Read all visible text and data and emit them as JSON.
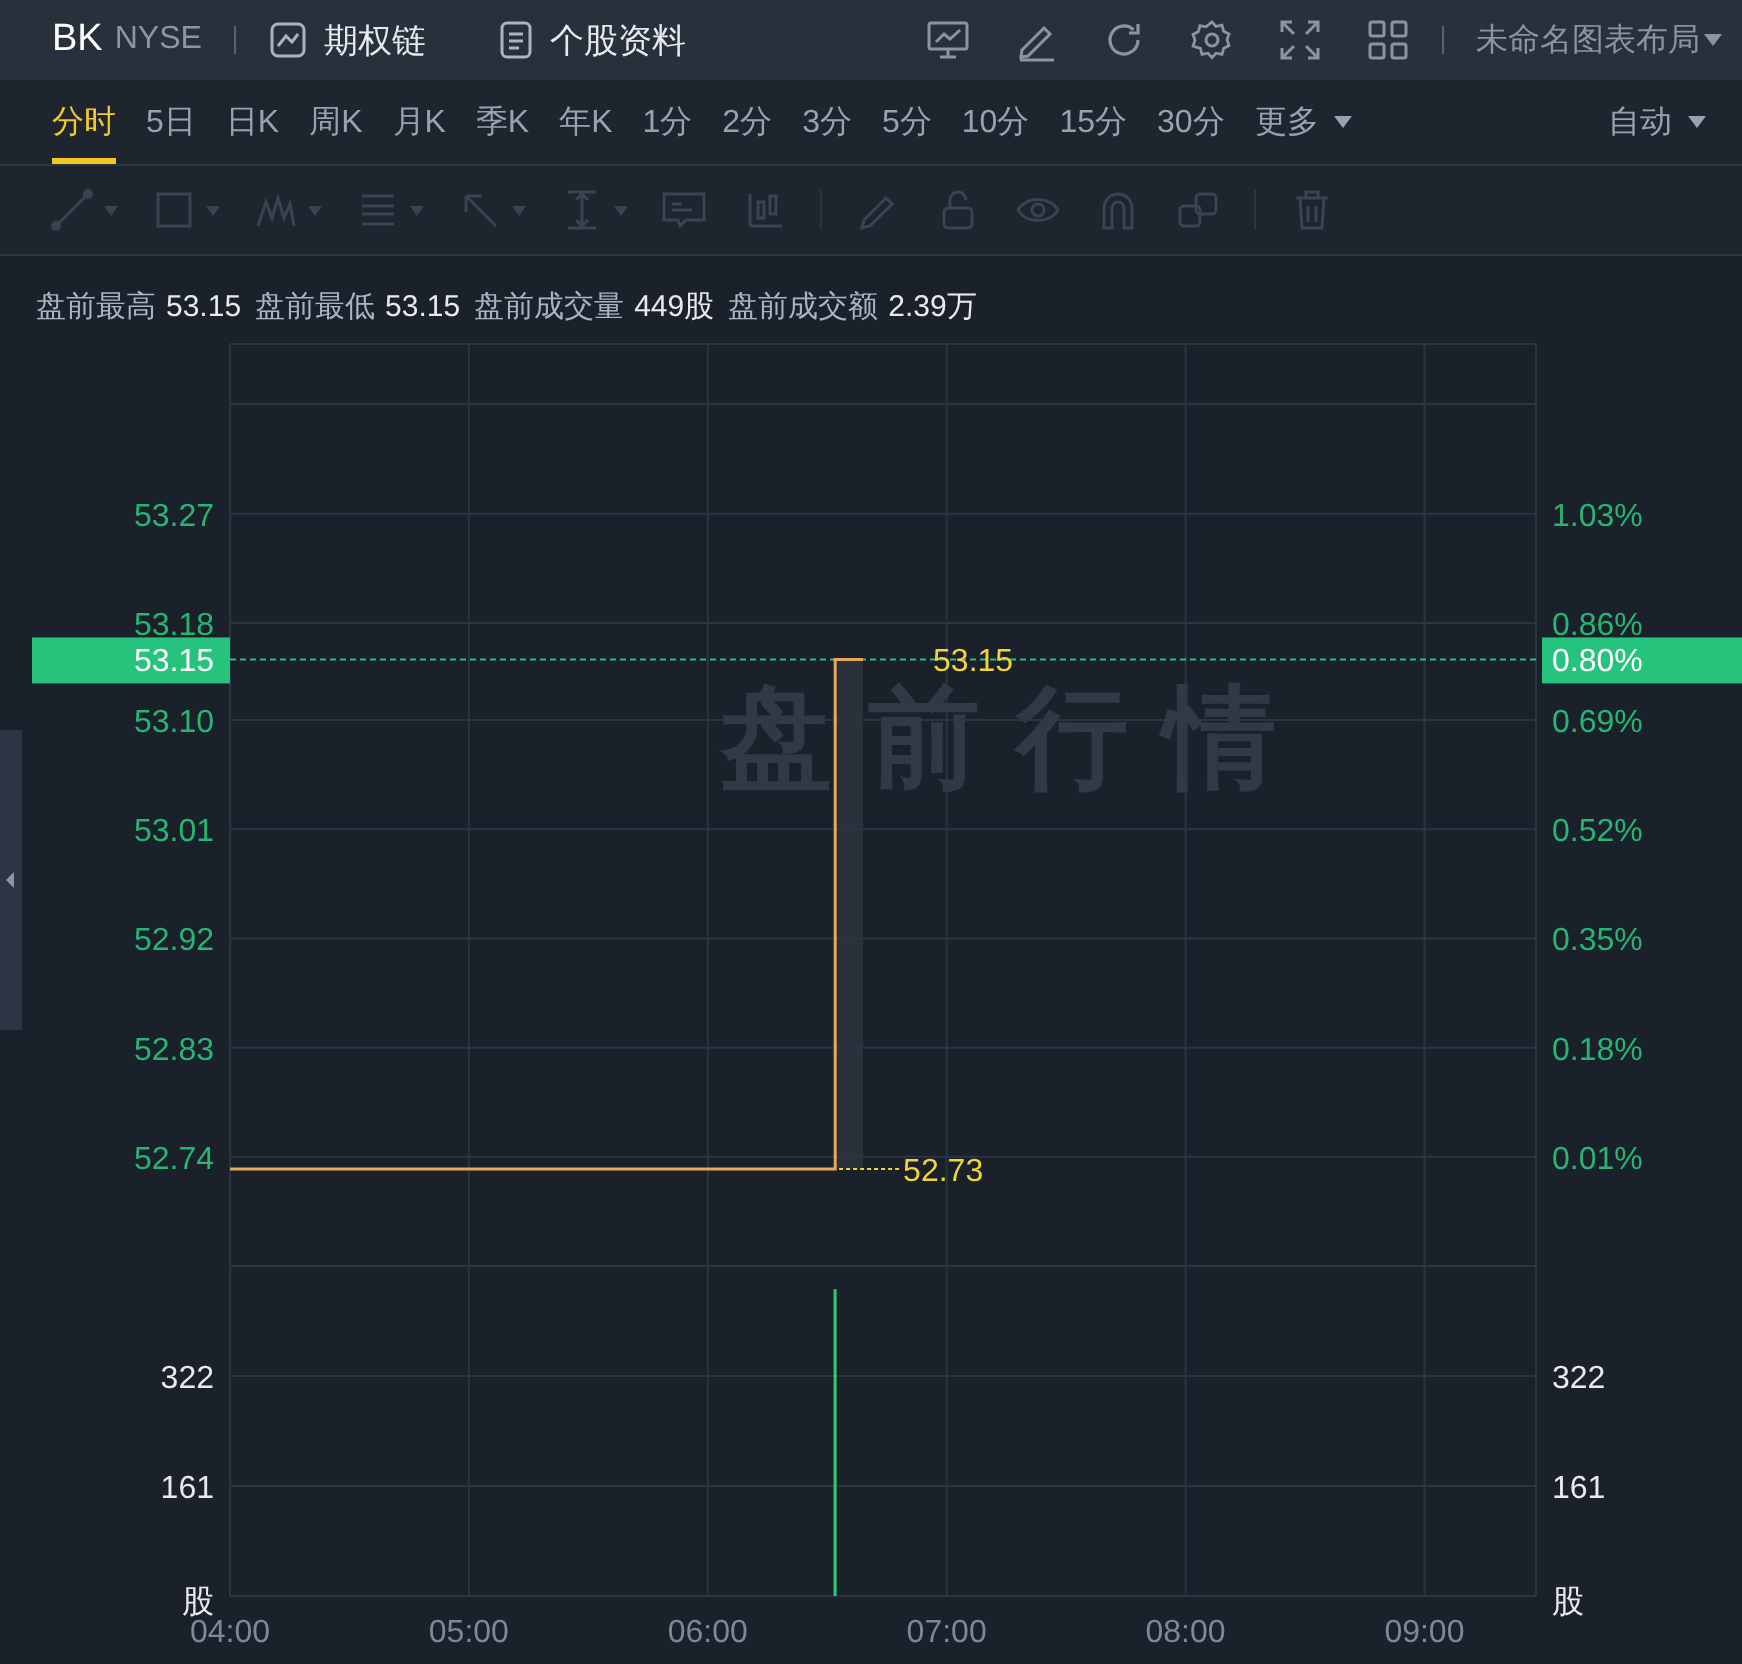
{
  "header": {
    "symbol": "BK",
    "exchange": "NYSE",
    "links": [
      {
        "kind": "chain",
        "label": "期权链"
      },
      {
        "kind": "profile",
        "label": "个股资料"
      }
    ],
    "tools": [
      {
        "kind": "monitor"
      },
      {
        "kind": "pen"
      },
      {
        "kind": "refresh"
      },
      {
        "kind": "gear"
      },
      {
        "kind": "expand"
      },
      {
        "kind": "grid"
      }
    ],
    "layout_menu": "未命名图表布局"
  },
  "timeframes": [
    {
      "label": "分时",
      "selected": true
    },
    {
      "label": "5日",
      "selected": false
    },
    {
      "label": "日K",
      "selected": false
    },
    {
      "label": "周K",
      "selected": false
    },
    {
      "label": "月K",
      "selected": false
    },
    {
      "label": "季K",
      "selected": false
    },
    {
      "label": "年K",
      "selected": false
    },
    {
      "label": "1分",
      "selected": false
    },
    {
      "label": "2分",
      "selected": false
    },
    {
      "label": "3分",
      "selected": false
    },
    {
      "label": "5分",
      "selected": false
    },
    {
      "label": "10分",
      "selected": false
    },
    {
      "label": "15分",
      "selected": false
    },
    {
      "label": "30分",
      "selected": false
    }
  ],
  "more_menu": "更多",
  "scale_menu": "自动",
  "drawing_tools": [
    {
      "kind": "line",
      "disabled": true
    },
    {
      "kind": "rect",
      "disabled": true
    },
    {
      "kind": "wave",
      "disabled": true
    },
    {
      "kind": "fib",
      "disabled": true
    },
    {
      "kind": "arrow",
      "disabled": true
    },
    {
      "kind": "measure",
      "disabled": true
    },
    {
      "kind": "note",
      "disabled": true
    },
    {
      "kind": "candles",
      "disabled": true
    },
    {
      "kind": "sep"
    },
    {
      "kind": "pen",
      "disabled": true
    },
    {
      "kind": "lock",
      "disabled": true
    },
    {
      "kind": "eye",
      "disabled": true
    },
    {
      "kind": "magnet",
      "disabled": true
    },
    {
      "kind": "copy",
      "disabled": true
    },
    {
      "kind": "sep"
    },
    {
      "kind": "trash",
      "disabled": true
    }
  ],
  "stats": [
    {
      "label": "盘前最高",
      "value": "53.15"
    },
    {
      "label": "盘前最低",
      "value": "53.15"
    },
    {
      "label": "盘前成交量",
      "value": "449股"
    },
    {
      "label": "盘前成交额",
      "value": "2.39万"
    }
  ],
  "price_chart": {
    "watermark": "盘前行情",
    "percent_ticks": [
      "1.03%",
      "0.86%",
      "0.69%",
      "0.52%",
      "0.35%",
      "0.18%",
      "0.01%"
    ],
    "last_price": {
      "price": "53.15",
      "percent": "0.80%"
    },
    "high_label": "53.15",
    "low_label": "52.73",
    "chart_data": {
      "type": "line",
      "grid": true,
      "ref_lines": [
        {
          "axis": "y",
          "value": 53.15,
          "color": "#27c07c"
        }
      ],
      "x": [
        4,
        6.533,
        6.533,
        6.65
      ],
      "xlim": [
        4,
        9.467
      ],
      "ylim": [
        52.65,
        53.41
      ],
      "yticks": [
        {
          "value": 53.27,
          "label": "53.27"
        },
        {
          "value": 53.18,
          "label": "53.18"
        },
        {
          "value": 53.1,
          "label": "53.10"
        },
        {
          "value": 53.01,
          "label": "53.01"
        },
        {
          "value": 52.92,
          "label": "52.92"
        },
        {
          "value": 52.83,
          "label": "52.83"
        },
        {
          "value": 52.74,
          "label": "52.74"
        }
      ],
      "series": [
        {
          "color": "#e8a85c",
          "values": [
            52.73,
            52.73,
            53.15,
            53.15
          ]
        }
      ]
    }
  },
  "volume_chart": {
    "unit_left": "股",
    "unit_right": "股",
    "right_ticks": [
      "322",
      "161"
    ],
    "chart_data": {
      "type": "bar",
      "grid": true,
      "x": [
        6.533
      ],
      "values": [
        449
      ],
      "xlim": [
        4,
        9.467
      ],
      "xticks": [
        {
          "value": 4,
          "label": "04:00"
        },
        {
          "value": 5,
          "label": "05:00"
        },
        {
          "value": 6,
          "label": "06:00"
        },
        {
          "value": 7,
          "label": "07:00"
        },
        {
          "value": 8,
          "label": "08:00"
        },
        {
          "value": 9,
          "label": "09:00"
        }
      ],
      "ylim": [
        0,
        483
      ],
      "yticks": [
        {
          "value": 322,
          "label": "322"
        },
        {
          "value": 161,
          "label": "161"
        }
      ]
    }
  }
}
